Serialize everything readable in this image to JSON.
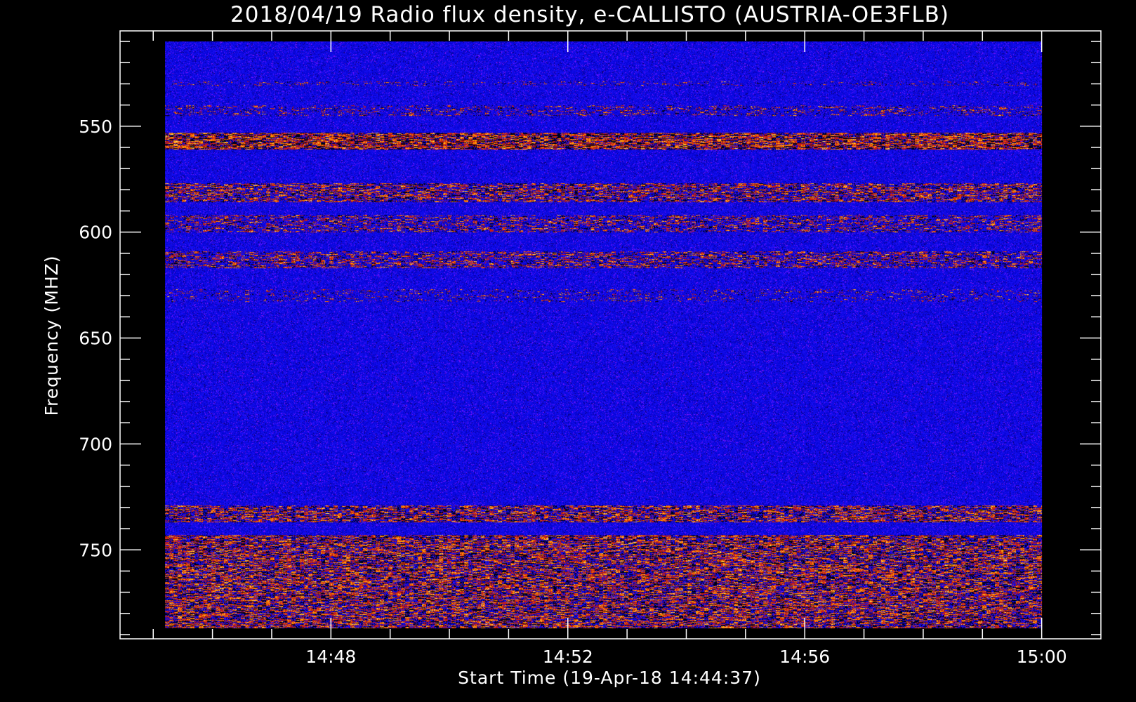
{
  "chart_data": {
    "type": "heatmap",
    "title": "2018/04/19  Radio flux density, e-CALLISTO (AUSTRIA-OE3FLB)",
    "xlabel": "Start Time (19-Apr-18 14:44:37)",
    "ylabel": "Frequency (MHZ)",
    "x_ticks": [
      "14:48",
      "14:52",
      "14:56",
      "15:00"
    ],
    "x_tick_minutes": [
      48,
      52,
      56,
      60
    ],
    "xlim_minutes": [
      45.2,
      60.0
    ],
    "axis_xlim_minutes": [
      44.44,
      61.0
    ],
    "y_ticks": [
      "550",
      "600",
      "650",
      "700",
      "750"
    ],
    "y_tick_values": [
      550,
      600,
      650,
      700,
      750
    ],
    "ylim": [
      510,
      787
    ],
    "axis_ylim": [
      505,
      792
    ],
    "y_inverted": true,
    "colormap": [
      "#000000",
      "#1e10e8",
      "#c01818",
      "#ff7a00",
      "#ffe070"
    ],
    "background": "#0c0cff",
    "emission_bands_mhz": [
      {
        "from": 529,
        "to": 531,
        "level": 0.35
      },
      {
        "from": 540,
        "to": 545,
        "level": 0.45
      },
      {
        "from": 553,
        "to": 561,
        "level": 0.95
      },
      {
        "from": 577,
        "to": 586,
        "level": 0.75
      },
      {
        "from": 592,
        "to": 600,
        "level": 0.6
      },
      {
        "from": 609,
        "to": 617,
        "level": 0.65
      },
      {
        "from": 627,
        "to": 633,
        "level": 0.35
      },
      {
        "from": 729,
        "to": 737,
        "level": 0.8
      },
      {
        "from": 743,
        "to": 787,
        "level": 0.85
      }
    ]
  }
}
